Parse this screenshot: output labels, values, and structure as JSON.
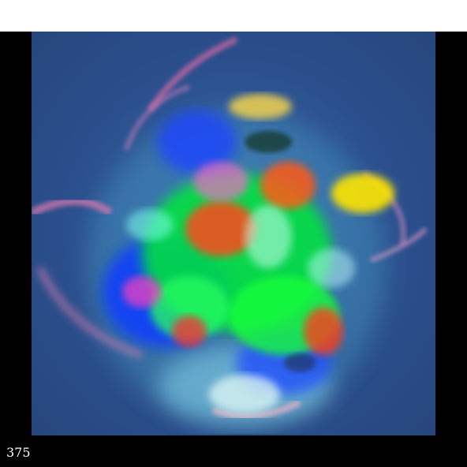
{
  "frame": {
    "counter_text": "375"
  },
  "image": {
    "subject": "abstract-nebula-render",
    "background_color": "#2b4f8c",
    "palette": [
      "#00ff3a",
      "#0a3cff",
      "#ff4a1a",
      "#ffe600",
      "#ff66cc",
      "#c9fff2"
    ]
  }
}
